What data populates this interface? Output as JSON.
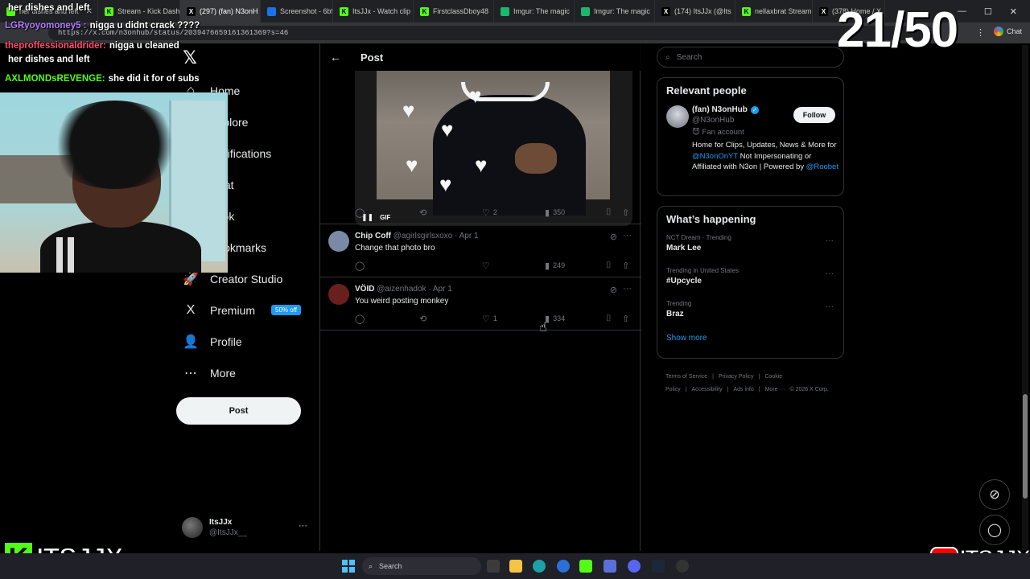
{
  "browser": {
    "tabs": [
      {
        "label": "her dishes and left",
        "color": "#53fc18",
        "glyph": "",
        "active": false
      },
      {
        "label": "Stream - Kick Dash",
        "color": "#53fc18",
        "glyph": "K",
        "active": false
      },
      {
        "label": "(297) (fan) N3onH",
        "color": "#000000",
        "glyph": "X",
        "active": true
      },
      {
        "label": "Screenshot - 6b9",
        "color": "#1a73e8",
        "glyph": "",
        "active": false
      },
      {
        "label": "ItsJJx - Watch clip",
        "color": "#53fc18",
        "glyph": "K",
        "active": false
      },
      {
        "label": "FirstclassDboy48",
        "color": "#53fc18",
        "glyph": "K",
        "active": false
      },
      {
        "label": "Imgur: The magic",
        "color": "#1bb76e",
        "glyph": "",
        "active": false
      },
      {
        "label": "Imgur: The magic",
        "color": "#1bb76e",
        "glyph": "",
        "active": false
      },
      {
        "label": "(174) ItsJJx (@Its",
        "color": "#000000",
        "glyph": "X",
        "active": false
      },
      {
        "label": "nellaxbrat Stream",
        "color": "#53fc18",
        "glyph": "K",
        "active": false
      },
      {
        "label": "(378) Home / X",
        "color": "#000000",
        "glyph": "X",
        "active": false
      }
    ],
    "url": "https://x.com/n3onhub/status/2039476659161361369?s=46",
    "chat_label": "Chat"
  },
  "nav": {
    "items": [
      {
        "label": "Home",
        "icon": "home-icon",
        "glyph": "⌂"
      },
      {
        "label": "Explore",
        "icon": "explore-icon",
        "glyph": "⌕"
      },
      {
        "label": "Notifications",
        "icon": "bell-icon",
        "glyph": "🔔"
      },
      {
        "label": "Chat",
        "icon": "chat-icon",
        "glyph": "✉"
      },
      {
        "label": "Grok",
        "icon": "grok-icon",
        "glyph": "◩"
      },
      {
        "label": "Bookmarks",
        "icon": "bookmark-icon",
        "glyph": "🔖"
      },
      {
        "label": "Creator Studio",
        "icon": "rocket-icon",
        "glyph": "🚀"
      },
      {
        "label": "Premium",
        "icon": "x-premium-icon",
        "glyph": "X",
        "badge": "50% off"
      },
      {
        "label": "Profile",
        "icon": "person-icon",
        "glyph": "👤"
      },
      {
        "label": "More",
        "icon": "more-circle-icon",
        "glyph": "⋯"
      }
    ],
    "post_label": "Post",
    "account": {
      "name": "ItsJJx",
      "handle": "@ItsJJx__"
    }
  },
  "post": {
    "header_title": "Post",
    "gif_label": "GIF",
    "stats": {
      "likes": "2",
      "views": "350"
    }
  },
  "replies": [
    {
      "name": "Chip Coff",
      "handle": "@agirlsgirlsxoxo",
      "date": "· Apr 1",
      "text": "Change that photo bro",
      "likes": "",
      "views": "249",
      "reposts": "",
      "avatar": "#7a8aa6"
    },
    {
      "name": "VÖID",
      "handle": "@aizenhadok",
      "date": "· Apr 1",
      "text": "You weird posting monkey",
      "likes": "1",
      "views": "334",
      "reposts": "",
      "avatar": "#6a1f1f"
    }
  ],
  "sidebar": {
    "search_placeholder": "Search",
    "relevant_title": "Relevant people",
    "person": {
      "name": "(fan) N3onHub",
      "handle": "@N3onHub",
      "follow_label": "Follow",
      "label": "😈 Fan account",
      "bio_1": "Home for Clips, Updates, News & More for ",
      "mention_1": "@N3onOnYT",
      "bio_2": " Not Impersonating or Affiliated with N3on | Powered by ",
      "mention_2": "@Roobet"
    },
    "happening_title": "What’s happening",
    "trends": [
      {
        "context": "NCT Dream · Trending",
        "title": "Mark Lee"
      },
      {
        "context": "Trending in United States",
        "title": "#Upcycle"
      },
      {
        "context": "Trending",
        "title": "Braz"
      }
    ],
    "show_more": "Show more",
    "footer": [
      "Terms of Service",
      "|",
      "Privacy Policy",
      "|",
      "Cookie Policy",
      "|",
      "Accessibility",
      "|",
      "Ads info",
      "|",
      "More ···",
      "© 2026 X Corp."
    ]
  },
  "stream": {
    "chat": [
      {
        "user": "",
        "color": "#ffffff",
        "text": "her dishes and left"
      },
      {
        "user": "LGRyoyomoney5 :",
        "color": "#b57cff",
        "text": "nigga u didnt crack ????"
      },
      {
        "user": "theproffessionaldrider:",
        "color": "#ff4d6d",
        "text": "nigga u cleaned"
      },
      {
        "user": "",
        "color": "#ffffff",
        "text": "her dishes and left"
      },
      {
        "user": "AXLMONDsREVENGE:",
        "color": "#53fc18",
        "text": "she did it for of subs"
      }
    ],
    "counter": "21/50",
    "brand_left": "ITSJJX",
    "brand_left_k": "K",
    "brand_right": "ITSJJX"
  },
  "taskbar": {
    "search_label": "Search"
  }
}
